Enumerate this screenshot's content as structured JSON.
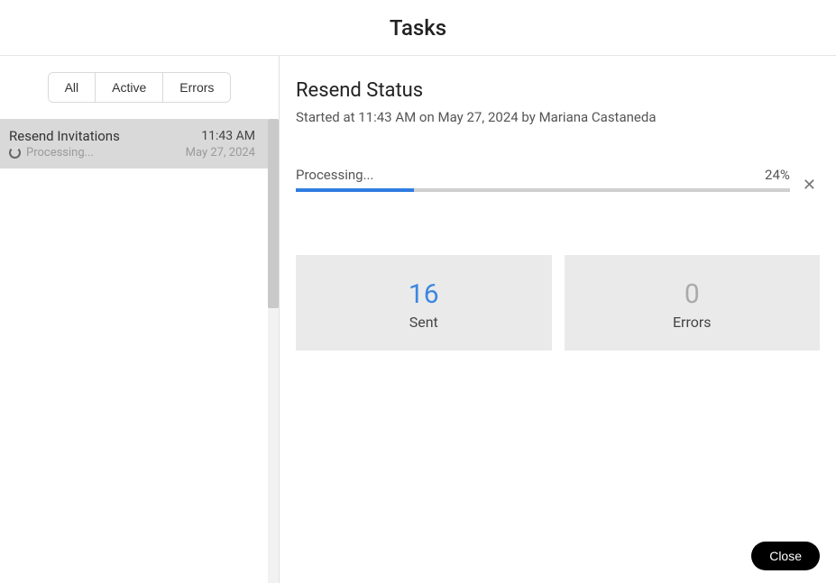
{
  "header": {
    "title": "Tasks"
  },
  "sidebar": {
    "filters": {
      "all": "All",
      "active": "Active",
      "errors": "Errors"
    },
    "tasks": [
      {
        "name": "Resend Invitations",
        "time": "11:43 AM",
        "status": "Processing...",
        "date": "May 27, 2024"
      }
    ]
  },
  "main": {
    "title": "Resend Status",
    "subtitle": "Started at 11:43 AM on May 27, 2024 by Mariana Castaneda",
    "progress": {
      "label": "Processing...",
      "percent_text": "24%",
      "percent_value": 24
    },
    "stats": {
      "sent": {
        "value": "16",
        "label": "Sent"
      },
      "errors": {
        "value": "0",
        "label": "Errors"
      }
    }
  },
  "footer": {
    "close": "Close"
  }
}
